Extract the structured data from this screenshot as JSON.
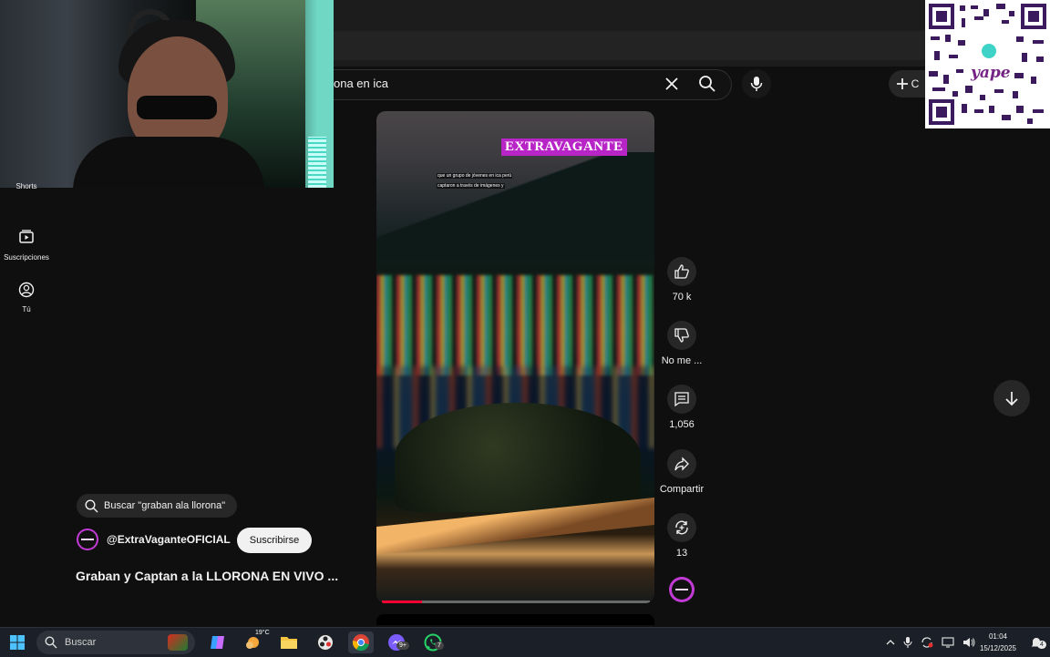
{
  "search": {
    "query": "ona en ica"
  },
  "header": {
    "create_label": "C"
  },
  "sidebar": {
    "items": [
      {
        "label": "Shorts",
        "icon": "shorts-icon"
      },
      {
        "label": "Suscripciones",
        "icon": "subscriptions-icon"
      },
      {
        "label": "Tú",
        "icon": "you-icon"
      }
    ]
  },
  "short": {
    "brand_overlay": "EXTRAVAGANTE",
    "captions": [
      "que un grupo de jóvenes en ica perú",
      "captaron a través de imágenes y"
    ],
    "progress": 0.15,
    "search_chip": "Buscar \"graban ala llorona\"",
    "channel": "@ExtraVaganteOFICIAL",
    "subscribe_label": "Suscribirse",
    "title": "Graban y Captan a la LLORONA EN VIVO ..."
  },
  "actions": {
    "likes": "70 k",
    "dislike_label": "No me ...",
    "comments": "1,056",
    "share_label": "Compartir",
    "remix_count": "13"
  },
  "qr": {
    "logo_text": "yape"
  },
  "taskbar": {
    "search_placeholder": "Buscar",
    "weather": "19°C",
    "whatsapp_badge": "7",
    "messenger_badge": "9+",
    "time": "01:04",
    "date": "15/12/2025",
    "notifications": "4"
  },
  "colors": {
    "accent": "#ff0033",
    "brand_purple": "#b825c7",
    "background": "#0f0f0f"
  }
}
